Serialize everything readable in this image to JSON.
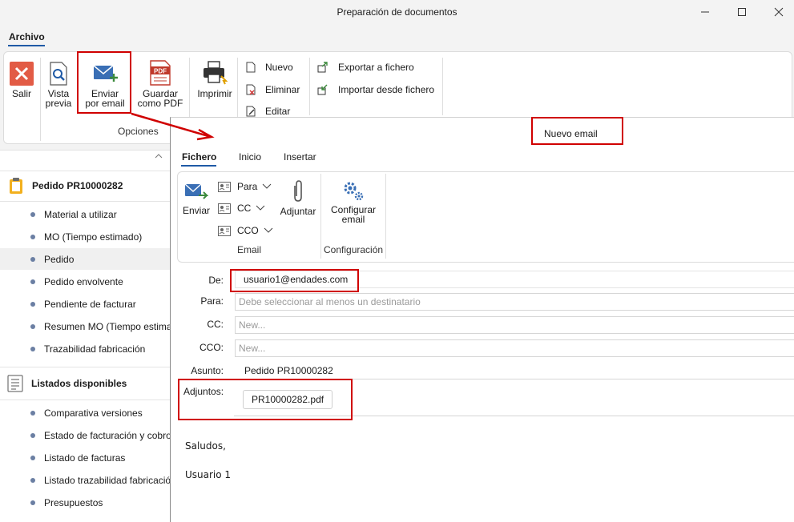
{
  "window": {
    "title": "Preparación de documentos"
  },
  "app_tabs": {
    "archivo": "Archivo"
  },
  "ribbon": {
    "salir": "Salir",
    "vista_previa_1": "Vista",
    "vista_previa_2": "previa",
    "enviar_email_1": "Enviar",
    "enviar_email_2": "por email",
    "guardar_pdf_1": "Guardar",
    "guardar_pdf_2": "como PDF",
    "pdf_badge": "PDF",
    "imprimir": "Imprimir",
    "nuevo": "Nuevo",
    "eliminar": "Eliminar",
    "editar": "Editar",
    "exportar": "Exportar a fichero",
    "importar": "Importar desde fichero",
    "group_opciones": "Opciones"
  },
  "left_panel": {
    "section1_title": "Pedido PR10000282",
    "section1_items": [
      "Material a utilizar",
      "MO (Tiempo estimado)",
      "Pedido",
      "Pedido envolvente",
      "Pendiente de facturar",
      "Resumen MO (Tiempo estima",
      "Trazabilidad fabricación"
    ],
    "section2_title": "Listados disponibles",
    "section2_items": [
      "Comparativa versiones",
      "Estado de facturación y cobro",
      "Listado de facturas",
      "Listado trazabilidad fabricación",
      "Presupuestos"
    ]
  },
  "email": {
    "window_title": "Nuevo email",
    "tabs": [
      "Fichero",
      "Inicio",
      "Insertar"
    ],
    "ribbon": {
      "enviar": "Enviar",
      "para": "Para",
      "cc": "CC",
      "cco": "CCO",
      "adjuntar": "Adjuntar",
      "configurar_1": "Configurar",
      "configurar_2": "email",
      "group_email": "Email",
      "group_config": "Configuración"
    },
    "form": {
      "de_label": "De:",
      "de_value": "usuario1@endades.com",
      "para_label": "Para:",
      "para_placeholder": "Debe seleccionar al menos un destinatario",
      "cc_label": "CC:",
      "cc_placeholder": "New...",
      "cco_label": "CCO:",
      "cco_placeholder": "New...",
      "asunto_label": "Asunto:",
      "asunto_value": "Pedido PR10000282",
      "adjuntos_label": "Adjuntos:",
      "attachment": "PR10000282.pdf"
    },
    "body": {
      "line1": "Saludos,",
      "line2": "Usuario 1"
    }
  },
  "colors": {
    "accent": "#1f5aa6",
    "highlight": "#d00000",
    "salir": "#e25b45"
  }
}
